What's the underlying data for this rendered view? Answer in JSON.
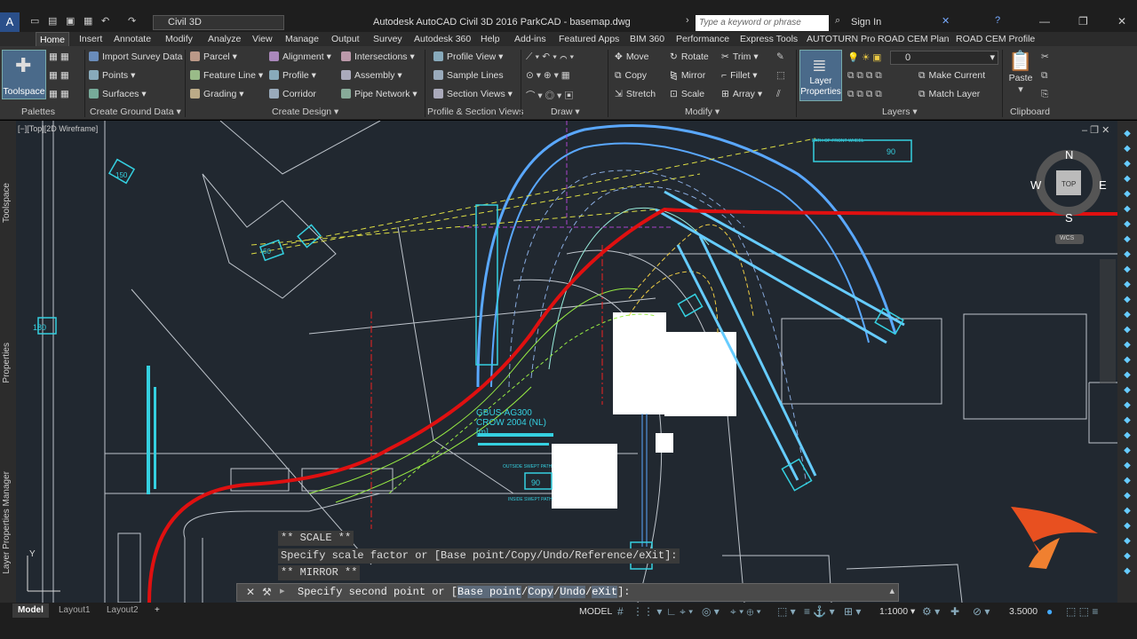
{
  "titlebar": {
    "app_letter": "A",
    "app_sub": "CIV",
    "workspace": "Civil 3D",
    "title": "Autodesk AutoCAD Civil 3D 2016    ParkCAD - basemap.dwg",
    "search_placeholder": "Type a keyword or phrase",
    "sign_in": "Sign In"
  },
  "tabs": [
    "Home",
    "Insert",
    "Annotate",
    "Modify",
    "Analyze",
    "View",
    "Manage",
    "Output",
    "Survey",
    "Autodesk 360",
    "Help",
    "Add-ins",
    "Featured Apps",
    "BIM 360",
    "Performance",
    "Express Tools",
    "AUTOTURN Pro",
    "ROAD CEM Plan",
    "ROAD CEM Profile"
  ],
  "ribbon": {
    "toolspace": "Toolspace",
    "palettes": "Palettes",
    "import_survey": "Import Survey Data",
    "points": "Points",
    "surfaces": "Surfaces",
    "create_ground_data": "Create Ground Data",
    "parcel": "Parcel",
    "feature_line": "Feature Line",
    "grading": "Grading",
    "alignment": "Alignment",
    "profile": "Profile",
    "corridor": "Corridor",
    "intersections": "Intersections",
    "assembly": "Assembly",
    "pipe_network": "Pipe Network",
    "create_design": "Create Design",
    "profile_view": "Profile View",
    "sample_lines": "Sample Lines",
    "section_views": "Section Views",
    "profile_section_views": "Profile & Section Views",
    "draw": "Draw",
    "move": "Move",
    "copy": "Copy",
    "stretch": "Stretch",
    "rotate": "Rotate",
    "mirror": "Mirror",
    "scale": "Scale",
    "trim": "Trim",
    "fillet": "Fillet",
    "array": "Array",
    "modify": "Modify",
    "layer_properties_1": "Layer",
    "layer_properties_2": "Properties",
    "layer_current": "0",
    "make_current": "Make Current",
    "match_layer": "Match Layer",
    "layers": "Layers",
    "paste": "Paste",
    "clipboard": "Clipboard"
  },
  "viewport": {
    "label": "[−][Top][2D Wireframe]",
    "compass": {
      "n": "N",
      "s": "S",
      "e": "E",
      "w": "W",
      "top": "TOP",
      "wcs": "WCS"
    },
    "annotations": {
      "gbus": "GBUS-AG300",
      "crow": "CROW 2004 (NL)",
      "unit": "[m]",
      "outside_swept": "OUTSIDE SWEPT PATH",
      "inside_swept": "INSIDE SWEPT PATH",
      "path_front": "PATH OF FRONT WHEEL",
      "deg90_a": "90",
      "deg90_b": "90",
      "deg180": "180",
      "deg150": "150",
      "deg60": "60",
      "ax_y": "Y",
      "ax_x": "X"
    }
  },
  "command": {
    "hist1": "** SCALE **",
    "hist2": "Specify scale factor or [Base point/Copy/Undo/Reference/eXit]:",
    "hist3": "** MIRROR **",
    "prompt_pre": "Specify second point or [",
    "opt1": "Base point",
    "opt2": "Copy",
    "opt3": "Undo",
    "opt4": "eXit",
    "prompt_post": "]:"
  },
  "left_palettes": [
    "Toolspace",
    "Properties",
    "Layer Properties Manager"
  ],
  "statusbar": {
    "layouts": [
      "Model",
      "Layout1",
      "Layout2"
    ],
    "add": "+",
    "model": "MODEL",
    "scale": "1:1000",
    "anno": "3.5000"
  },
  "colors": {
    "accent": "#4a6a8a",
    "red_path": "#e01010",
    "cyan": "#35d0e0",
    "blue_path": "#5aa8ff"
  }
}
